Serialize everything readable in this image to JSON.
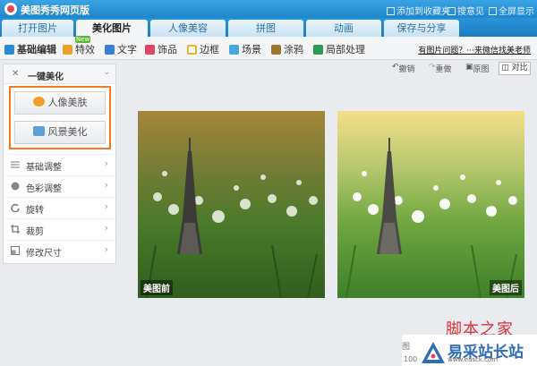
{
  "window": {
    "title": "美图秀秀网页版",
    "links": [
      "添加到收藏夹",
      "搜意见",
      "全屏显示"
    ]
  },
  "tabs": [
    {
      "label": "打开图片",
      "active": false
    },
    {
      "label": "美化图片",
      "active": true
    },
    {
      "label": "人像美容",
      "active": false
    },
    {
      "label": "拼图",
      "active": false
    },
    {
      "label": "动画",
      "active": false
    },
    {
      "label": "保存与分享",
      "active": false
    }
  ],
  "toolbar": {
    "items": [
      {
        "label": "基础编辑",
        "icon": "basic-edit-icon",
        "color": "#2a8bd2"
      },
      {
        "label": "特效",
        "icon": "effects-icon",
        "color": "#f0a028",
        "badge": "New"
      },
      {
        "label": "文字",
        "icon": "text-icon",
        "color": "#3b7fd0"
      },
      {
        "label": "饰品",
        "icon": "accessory-icon",
        "color": "#e0465c"
      },
      {
        "label": "边框",
        "icon": "frame-icon",
        "color": "#f0b12d"
      },
      {
        "label": "场景",
        "icon": "scene-icon",
        "color": "#4aa7d8"
      },
      {
        "label": "涂鸦",
        "icon": "brush-icon",
        "color": "#a0762f"
      },
      {
        "label": "局部处理",
        "icon": "local-process-icon",
        "color": "#2d9b55"
      }
    ],
    "help_link": "有图片问题？···来微信找美老师"
  },
  "left_panel": {
    "header": "一键美化",
    "buttons": [
      {
        "label": "人像美肤",
        "icon": "portrait-icon",
        "color": "#f0a028"
      },
      {
        "label": "风景美化",
        "icon": "landscape-icon",
        "color": "#5da0d8"
      }
    ],
    "menu": [
      {
        "label": "基础调整",
        "icon": "sliders-icon"
      },
      {
        "label": "色彩调整",
        "icon": "palette-icon"
      },
      {
        "label": "旋转",
        "icon": "rotate-icon"
      },
      {
        "label": "裁剪",
        "icon": "crop-icon"
      },
      {
        "label": "修改尺寸",
        "icon": "resize-icon"
      }
    ]
  },
  "canvas": {
    "actions": [
      "撤销",
      "重做",
      "原图"
    ],
    "contrast_label": "对比",
    "before_caption": "美图前",
    "after_caption": "美图后"
  },
  "watermark": {
    "line1": "脚本之家",
    "line2": "易采站长站",
    "line3": "www.easck.com",
    "stub1": "图",
    "stub2": "100"
  }
}
